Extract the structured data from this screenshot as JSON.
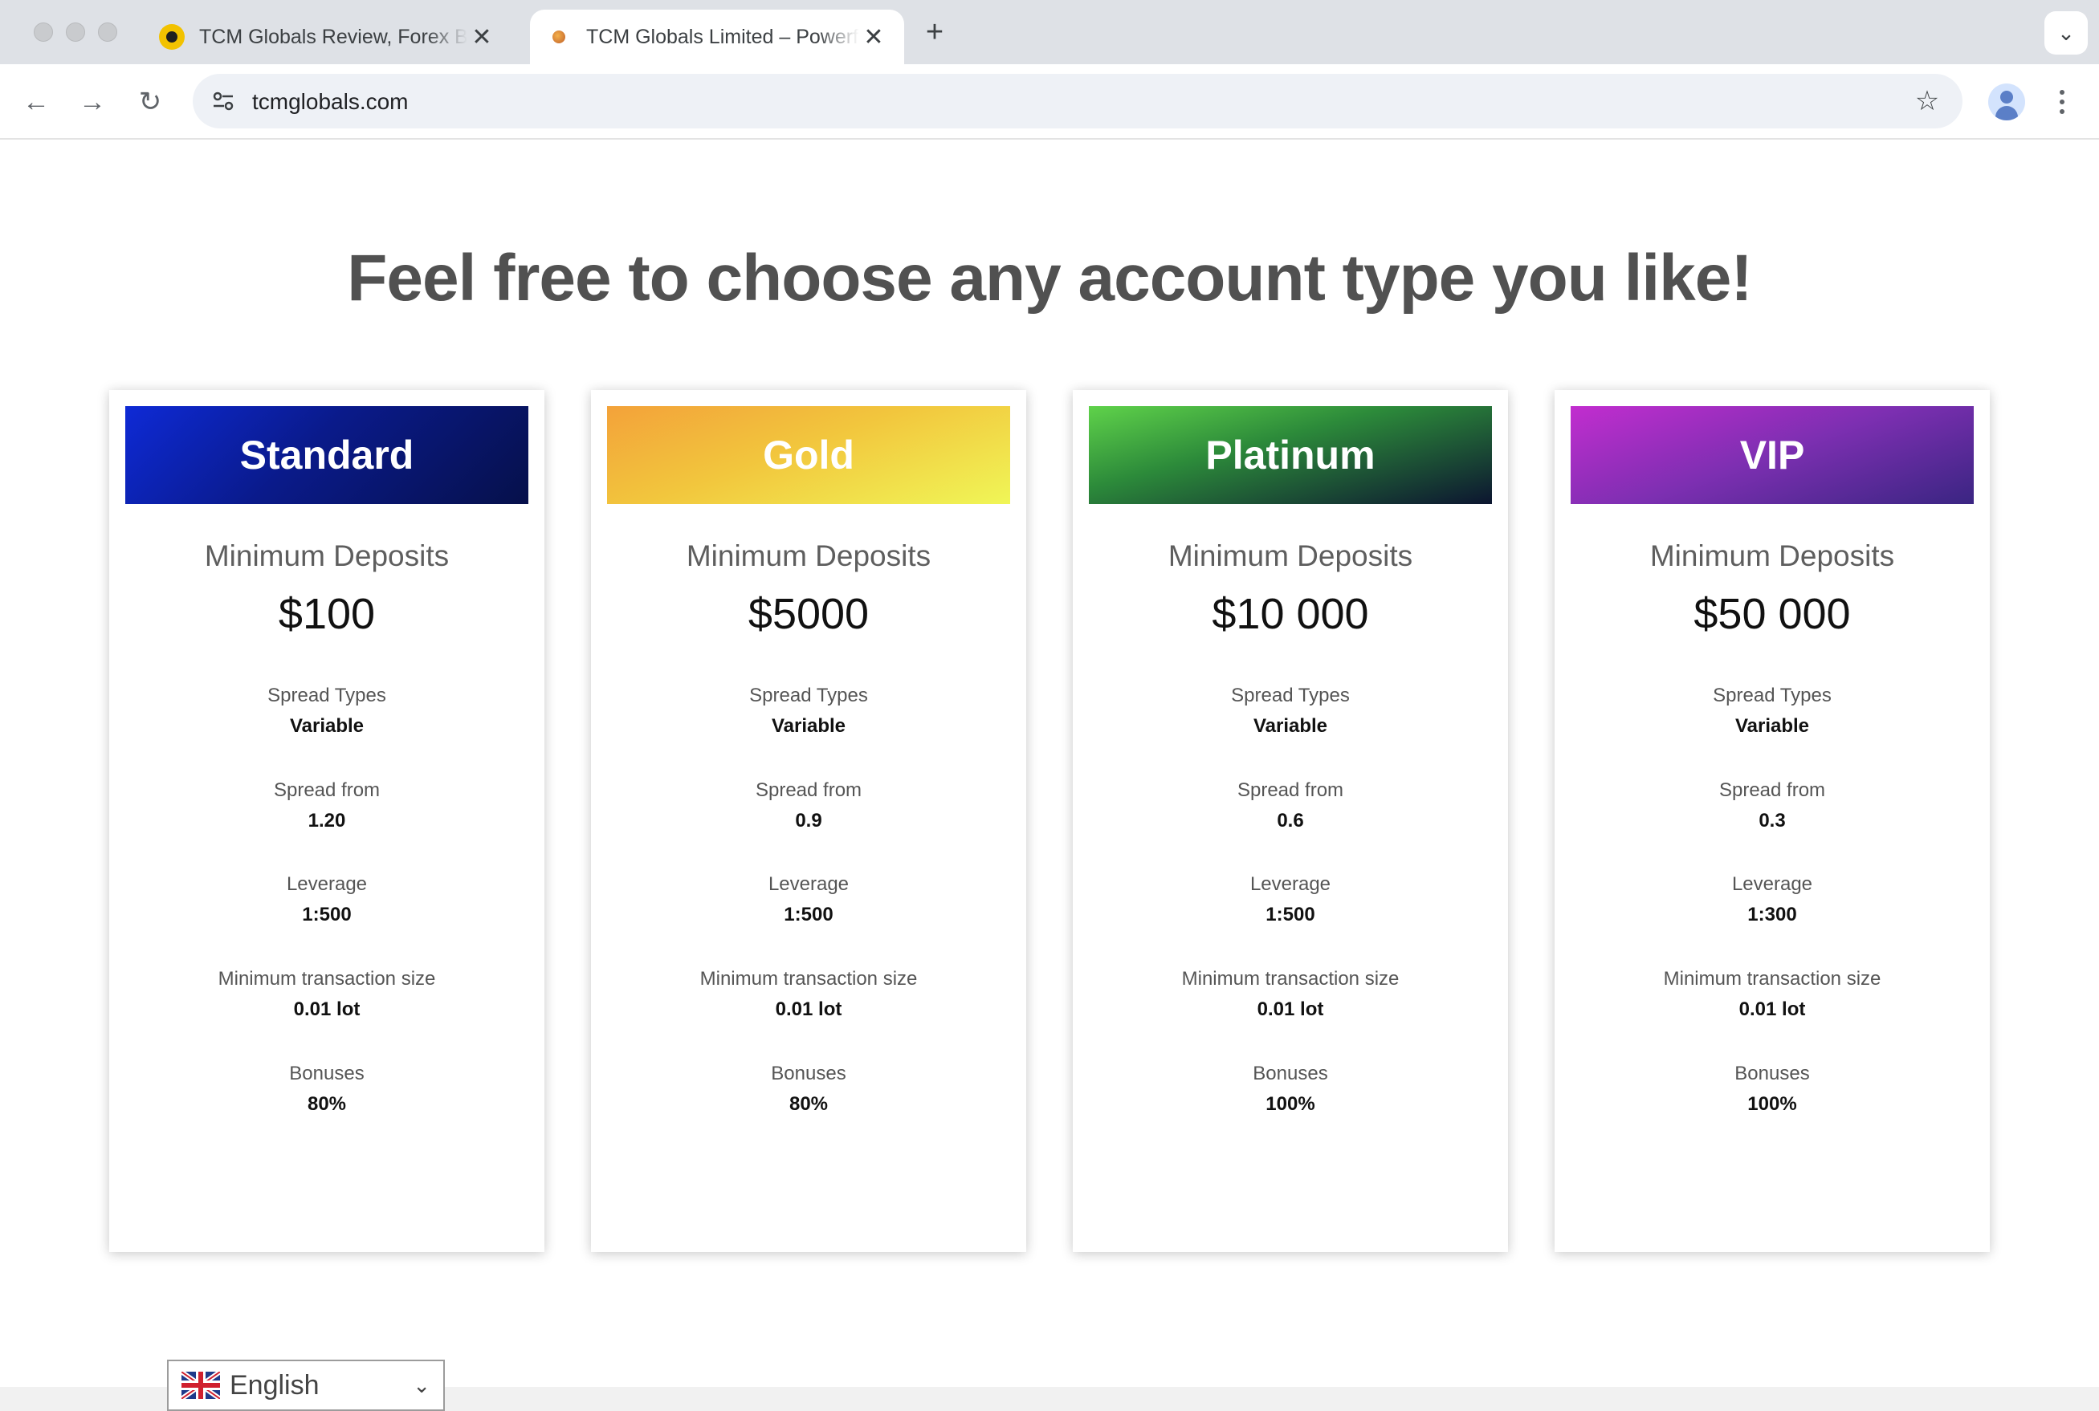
{
  "browser": {
    "tabs": [
      {
        "title": "TCM Globals Review, Forex Broker",
        "active": false
      },
      {
        "title": "TCM Globals Limited – Powerful",
        "active": true
      }
    ],
    "url": "tcmglobals.com"
  },
  "page": {
    "headline": "Feel free to choose any account type you like!",
    "min_deposit_label": "Minimum Deposits",
    "spec_labels": {
      "spread_types": "Spread Types",
      "spread_from": "Spread from",
      "leverage": "Leverage",
      "min_size": "Minimum transaction size",
      "bonuses": "Bonuses"
    },
    "accounts": [
      {
        "name": "Standard",
        "min_deposit": "$100",
        "spread_types": "Variable",
        "spread_from": "1.20",
        "leverage": "1:500",
        "min_size": "0.01 lot",
        "bonuses": "80%"
      },
      {
        "name": "Gold",
        "min_deposit": "$5000",
        "spread_types": "Variable",
        "spread_from": "0.9",
        "leverage": "1:500",
        "min_size": "0.01 lot",
        "bonuses": "80%"
      },
      {
        "name": "Platinum",
        "min_deposit": "$10 000",
        "spread_types": "Variable",
        "spread_from": "0.6",
        "leverage": "1:500",
        "min_size": "0.01 lot",
        "bonuses": "100%"
      },
      {
        "name": "VIP",
        "min_deposit": "$50 000",
        "spread_types": "Variable",
        "spread_from": "0.3",
        "leverage": "1:300",
        "min_size": "0.01 lot",
        "bonuses": "100%"
      }
    ],
    "language": {
      "selected": "English"
    }
  }
}
